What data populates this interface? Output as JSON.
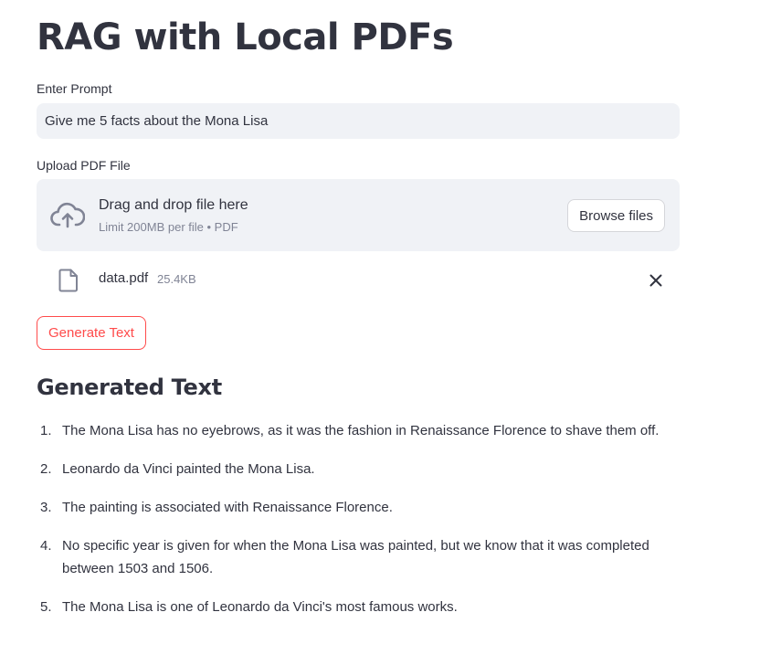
{
  "page": {
    "title": "RAG with Local PDFs"
  },
  "prompt": {
    "label": "Enter Prompt",
    "value": "Give me 5 facts about the Mona Lisa"
  },
  "upload": {
    "label": "Upload PDF File",
    "dropzone_title": "Drag and drop file here",
    "dropzone_limit": "Limit 200MB per file • PDF",
    "browse_label": "Browse files",
    "icon": "cloud-upload-icon",
    "file": {
      "name": "data.pdf",
      "size": "25.4KB",
      "icon": "file-icon",
      "remove_icon": "close-icon"
    }
  },
  "actions": {
    "generate_label": "Generate Text"
  },
  "output": {
    "heading": "Generated Text",
    "items": [
      {
        "num": "1.",
        "text": "The Mona Lisa has no eyebrows, as it was the fashion in Renaissance Florence to shave them off."
      },
      {
        "num": "2.",
        "text": "Leonardo da Vinci painted the Mona Lisa."
      },
      {
        "num": "3.",
        "text": "The painting is associated with Renaissance Florence."
      },
      {
        "num": "4.",
        "text": "No specific year is given for when the Mona Lisa was painted, but we know that it was completed between 1503 and 1506."
      },
      {
        "num": "5.",
        "text": "The Mona Lisa is one of Leonardo da Vinci's most famous works."
      }
    ]
  },
  "colors": {
    "accent": "#ff4b4b",
    "text": "#31333f",
    "muted": "#808495",
    "input_bg": "#f0f2f6"
  }
}
